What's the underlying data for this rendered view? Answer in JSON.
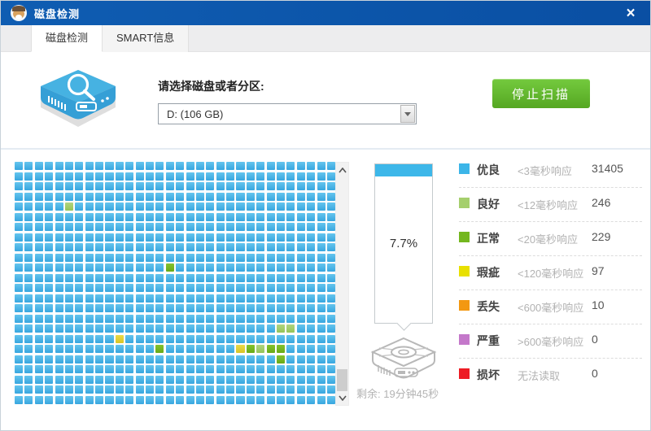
{
  "window": {
    "title": "磁盘检测",
    "close": "×"
  },
  "tabs": {
    "disk_check": "磁盘检测",
    "smart_info": "SMART信息"
  },
  "scan": {
    "select_label": "请选择磁盘或者分区:",
    "selected_disk": "D: (106 GB)",
    "stop_button": "停止扫描"
  },
  "progress": {
    "percent_label": "7.7%",
    "percent_value": 7.7,
    "remaining": "剩余: 19分钟45秒"
  },
  "grid": {
    "rows": 24,
    "cols": 32,
    "cell_colors": {
      "blue": "#4bb4e4",
      "lightgreen": "#a2cc6b",
      "green": "#76b821",
      "yellow": "#e2d036"
    },
    "special_cells": [
      {
        "row": 4,
        "col": 5,
        "type": "lightgreen"
      },
      {
        "row": 10,
        "col": 15,
        "type": "green"
      },
      {
        "row": 16,
        "col": 26,
        "type": "lightgreen"
      },
      {
        "row": 16,
        "col": 27,
        "type": "lightgreen"
      },
      {
        "row": 17,
        "col": 10,
        "type": "yellow"
      },
      {
        "row": 18,
        "col": 14,
        "type": "green"
      },
      {
        "row": 18,
        "col": 22,
        "type": "yellow"
      },
      {
        "row": 18,
        "col": 23,
        "type": "green"
      },
      {
        "row": 18,
        "col": 24,
        "type": "lightgreen"
      },
      {
        "row": 18,
        "col": 25,
        "type": "green"
      },
      {
        "row": 18,
        "col": 26,
        "type": "green"
      },
      {
        "row": 19,
        "col": 26,
        "type": "green"
      }
    ]
  },
  "legend": {
    "rows": [
      {
        "color": "#3cb5e8",
        "label": "优良",
        "desc": "<3毫秒响应",
        "count": "31405"
      },
      {
        "color": "#a5cf6d",
        "label": "良好",
        "desc": "<12毫秒响应",
        "count": "246"
      },
      {
        "color": "#74b71f",
        "label": "正常",
        "desc": "<20毫秒响应",
        "count": "229"
      },
      {
        "color": "#e8e000",
        "label": "瑕疵",
        "desc": "<120毫秒响应",
        "count": "97"
      },
      {
        "color": "#f39812",
        "label": "丢失",
        "desc": "<600毫秒响应",
        "count": "10"
      },
      {
        "color": "#c478ca",
        "label": "严重",
        "desc": ">600毫秒响应",
        "count": "0"
      },
      {
        "color": "#ed1c24",
        "label": "损坏",
        "desc": "无法读取",
        "count": "0"
      }
    ]
  },
  "colors": {
    "titlebar": "#0d57ae",
    "accent_blue": "#3db7e9",
    "stop_button_green": "#5fb32c"
  }
}
